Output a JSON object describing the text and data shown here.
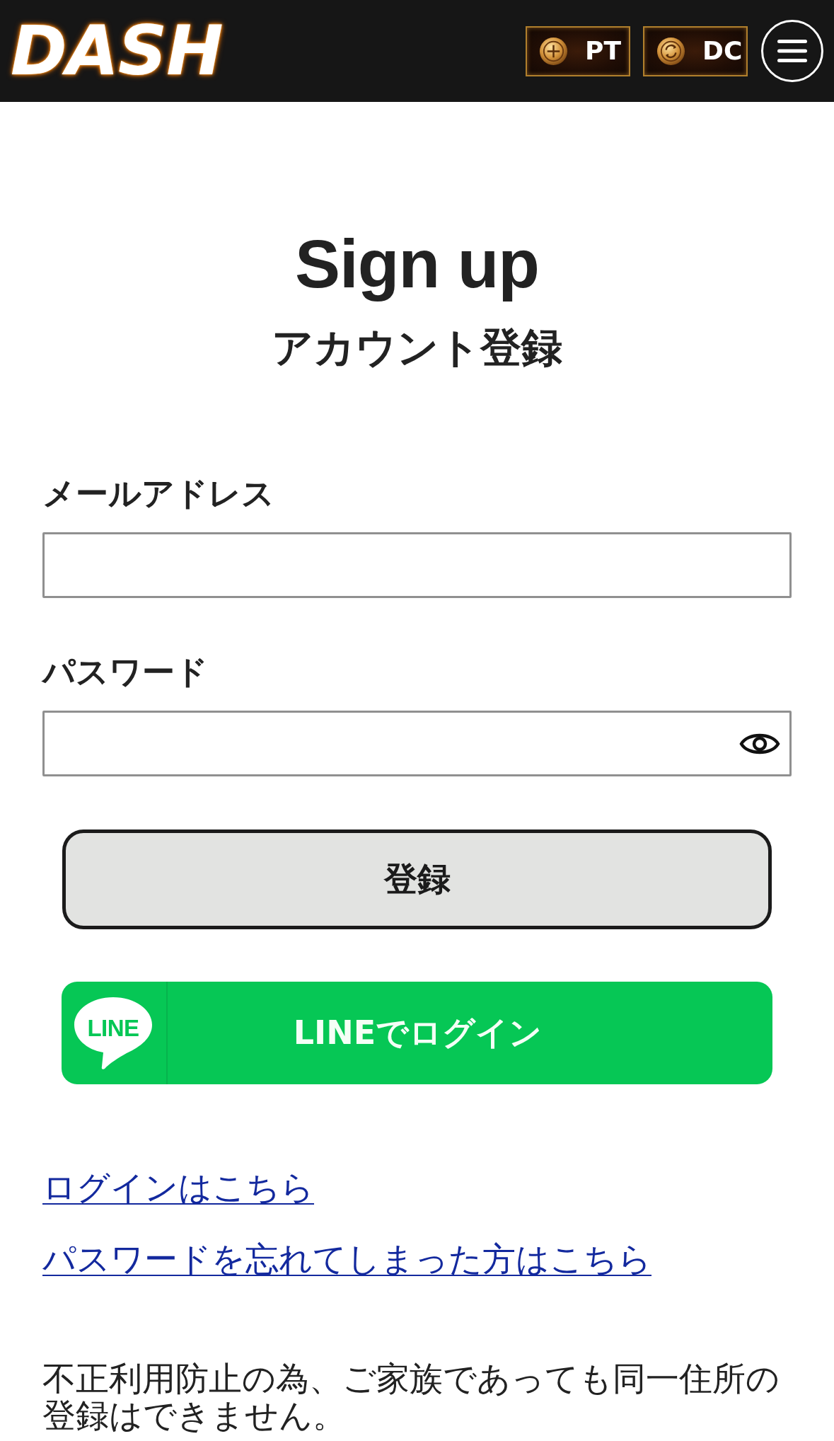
{
  "header": {
    "logo": "DASH",
    "badges": [
      {
        "kind": "points",
        "label": "PT"
      },
      {
        "kind": "coin",
        "label": "DC"
      }
    ]
  },
  "heading": {
    "title": "Sign up",
    "subtitle": "アカウント登録"
  },
  "form": {
    "fields": [
      {
        "kind": "email",
        "label": "メールアドレス"
      },
      {
        "kind": "password",
        "label": "パスワード"
      }
    ],
    "submit": "登録"
  },
  "line_login": {
    "logo": "LINE",
    "label": "LINEでログイン"
  },
  "links": [
    "ログインはこちら",
    "パスワードを忘れてしまった方はこちら"
  ],
  "notice": "不正利用防止の為、ご家族であっても同一住所の登録はできません。"
}
